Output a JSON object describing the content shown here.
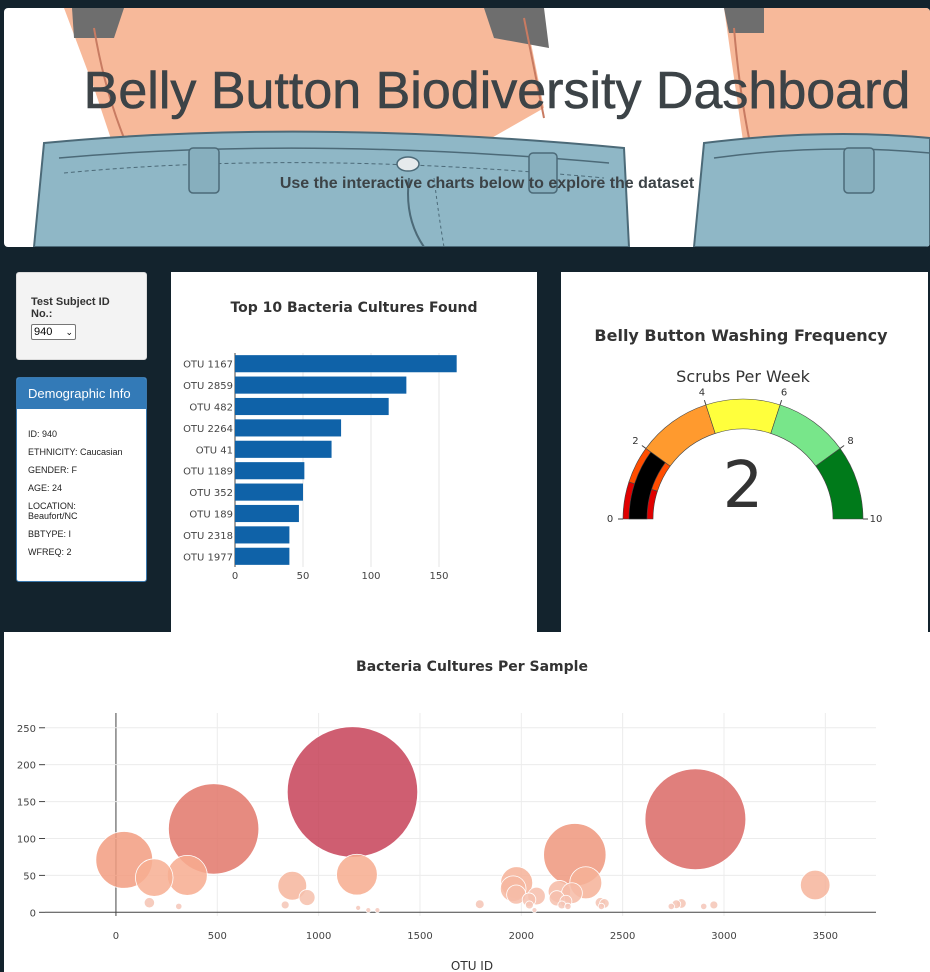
{
  "header": {
    "title": "Belly Button Biodiversity Dashboard",
    "subtitle": "Use the interactive charts below to explore the dataset"
  },
  "selector": {
    "label": "Test Subject ID No.:",
    "selected": "940"
  },
  "demographics": {
    "heading": "Demographic Info",
    "rows": [
      "ID: 940",
      "ETHNICITY: Caucasian",
      "GENDER: F",
      "AGE: 24",
      "LOCATION: Beaufort/NC",
      "BBTYPE: I",
      "WFREQ: 2"
    ]
  },
  "chart_data": [
    {
      "type": "bar",
      "orientation": "horizontal",
      "title": "Top 10 Bacteria Cultures Found",
      "categories": [
        "OTU 1167",
        "OTU 2859",
        "OTU 482",
        "OTU 2264",
        "OTU 41",
        "OTU 1189",
        "OTU 352",
        "OTU 189",
        "OTU 2318",
        "OTU 1977"
      ],
      "values": [
        163,
        126,
        113,
        78,
        71,
        51,
        50,
        47,
        40,
        40
      ],
      "xlim": [
        0,
        175
      ],
      "xticks": [
        0,
        50,
        100,
        150
      ],
      "color": "#0f62a8",
      "grid": true
    },
    {
      "type": "gauge",
      "title": "Belly Button Washing Frequency",
      "subtitle": "Scrubs Per Week",
      "value": 2,
      "range": [
        0,
        10
      ],
      "ticks": [
        0,
        2,
        4,
        6,
        8,
        10
      ],
      "steps": [
        {
          "range": [
            0,
            1
          ],
          "color": "#e00000"
        },
        {
          "range": [
            1,
            2
          ],
          "color": "#ff4d00"
        },
        {
          "range": [
            2,
            4
          ],
          "color": "#ff9a2e"
        },
        {
          "range": [
            4,
            6
          ],
          "color": "#ffff3c"
        },
        {
          "range": [
            6,
            8
          ],
          "color": "#78e68a"
        },
        {
          "range": [
            8,
            10
          ],
          "color": "#007a1a"
        }
      ],
      "bar_color": "#000000"
    },
    {
      "type": "scatter",
      "style": "bubble",
      "title": "Bacteria Cultures Per Sample",
      "xlabel": "OTU ID",
      "ylabel": "",
      "xlim": [
        -350,
        3750
      ],
      "ylim": [
        -5,
        270
      ],
      "xticks": [
        0,
        500,
        1000,
        1500,
        2000,
        2500,
        3000,
        3500
      ],
      "yticks": [
        0,
        50,
        100,
        150,
        200,
        250
      ],
      "grid": true,
      "colorscale": [
        "#f5cbc0",
        "#f7a888",
        "#e2776a",
        "#c33a55"
      ],
      "points": [
        {
          "x": 1167,
          "y": 163
        },
        {
          "x": 2859,
          "y": 126
        },
        {
          "x": 482,
          "y": 113
        },
        {
          "x": 2264,
          "y": 78
        },
        {
          "x": 41,
          "y": 71
        },
        {
          "x": 1189,
          "y": 51
        },
        {
          "x": 352,
          "y": 50
        },
        {
          "x": 189,
          "y": 47
        },
        {
          "x": 2318,
          "y": 40
        },
        {
          "x": 1977,
          "y": 40
        },
        {
          "x": 3450,
          "y": 37
        },
        {
          "x": 870,
          "y": 36
        },
        {
          "x": 1960,
          "y": 32
        },
        {
          "x": 2188,
          "y": 28
        },
        {
          "x": 2250,
          "y": 26
        },
        {
          "x": 1975,
          "y": 24
        },
        {
          "x": 2075,
          "y": 22
        },
        {
          "x": 943,
          "y": 20
        },
        {
          "x": 2175,
          "y": 19
        },
        {
          "x": 2038,
          "y": 17
        },
        {
          "x": 2220,
          "y": 15
        },
        {
          "x": 165,
          "y": 13
        },
        {
          "x": 2390,
          "y": 13
        },
        {
          "x": 2410,
          "y": 12
        },
        {
          "x": 2790,
          "y": 12
        },
        {
          "x": 2765,
          "y": 11
        },
        {
          "x": 1795,
          "y": 11
        },
        {
          "x": 2200,
          "y": 10
        },
        {
          "x": 2040,
          "y": 10
        },
        {
          "x": 2950,
          "y": 10
        },
        {
          "x": 835,
          "y": 10
        },
        {
          "x": 2740,
          "y": 8
        },
        {
          "x": 310,
          "y": 8
        },
        {
          "x": 2395,
          "y": 8
        },
        {
          "x": 2230,
          "y": 8
        },
        {
          "x": 2900,
          "y": 8
        },
        {
          "x": 1195,
          "y": 6
        },
        {
          "x": 1290,
          "y": 3
        },
        {
          "x": 1245,
          "y": 3
        },
        {
          "x": 2065,
          "y": 3
        }
      ]
    }
  ]
}
